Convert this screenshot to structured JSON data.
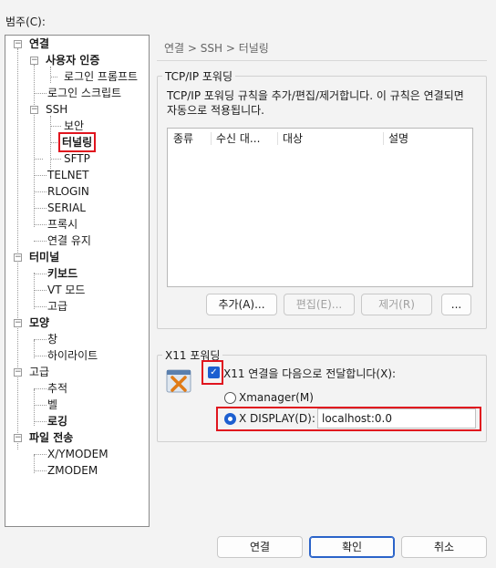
{
  "category_label": "범주(C):",
  "tree": {
    "connection": "연결",
    "auth": "사용자 인증",
    "login_prompt": "로그인 프롬프트",
    "login_script": "로그인 스크립트",
    "ssh": "SSH",
    "security": "보안",
    "tunneling": "터널링",
    "sftp": "SFTP",
    "telnet": "TELNET",
    "rlogin": "RLOGIN",
    "serial": "SERIAL",
    "proxy": "프록시",
    "keepalive": "연결 유지",
    "terminal": "터미널",
    "keyboard": "키보드",
    "vtmode": "VT 모드",
    "advanced_t": "고급",
    "appearance": "모양",
    "window": "창",
    "highlight": "하이라이트",
    "advanced": "고급",
    "trace": "추적",
    "bell": "벨",
    "logging": "로깅",
    "filetransfer": "파일 전송",
    "xymodem": "X/YMODEM",
    "zmodem": "ZMODEM"
  },
  "breadcrumb": "연결 > SSH > 터널링",
  "tcpip": {
    "title": "TCP/IP 포워딩",
    "description": "TCP/IP 포워딩 규칙을 추가/편집/제거합니다. 이 규칙은 연결되면 자동으로 적용됩니다.",
    "columns": [
      "종류",
      "수신 대...",
      "대상",
      "설명"
    ],
    "add": "추가(A)...",
    "edit": "편집(E)...",
    "remove": "제거(R)",
    "more": "..."
  },
  "x11": {
    "title": "X11 포워딩",
    "forward_label": "X11 연결을 다음으로 전달합니다(X):",
    "xmanager": "Xmanager(M)",
    "xdisplay": "X DISPLAY(D):",
    "xdisplay_value": "localhost:0.0"
  },
  "footer": {
    "connect": "연결",
    "ok": "확인",
    "cancel": "취소"
  },
  "state": {
    "x11_forward_checked": true,
    "selected_radio": "X DISPLAY(D):",
    "selected_tree_item": "터널링"
  },
  "colors": {
    "accent": "#1d5fd0",
    "highlight_box": "#e0141e"
  }
}
